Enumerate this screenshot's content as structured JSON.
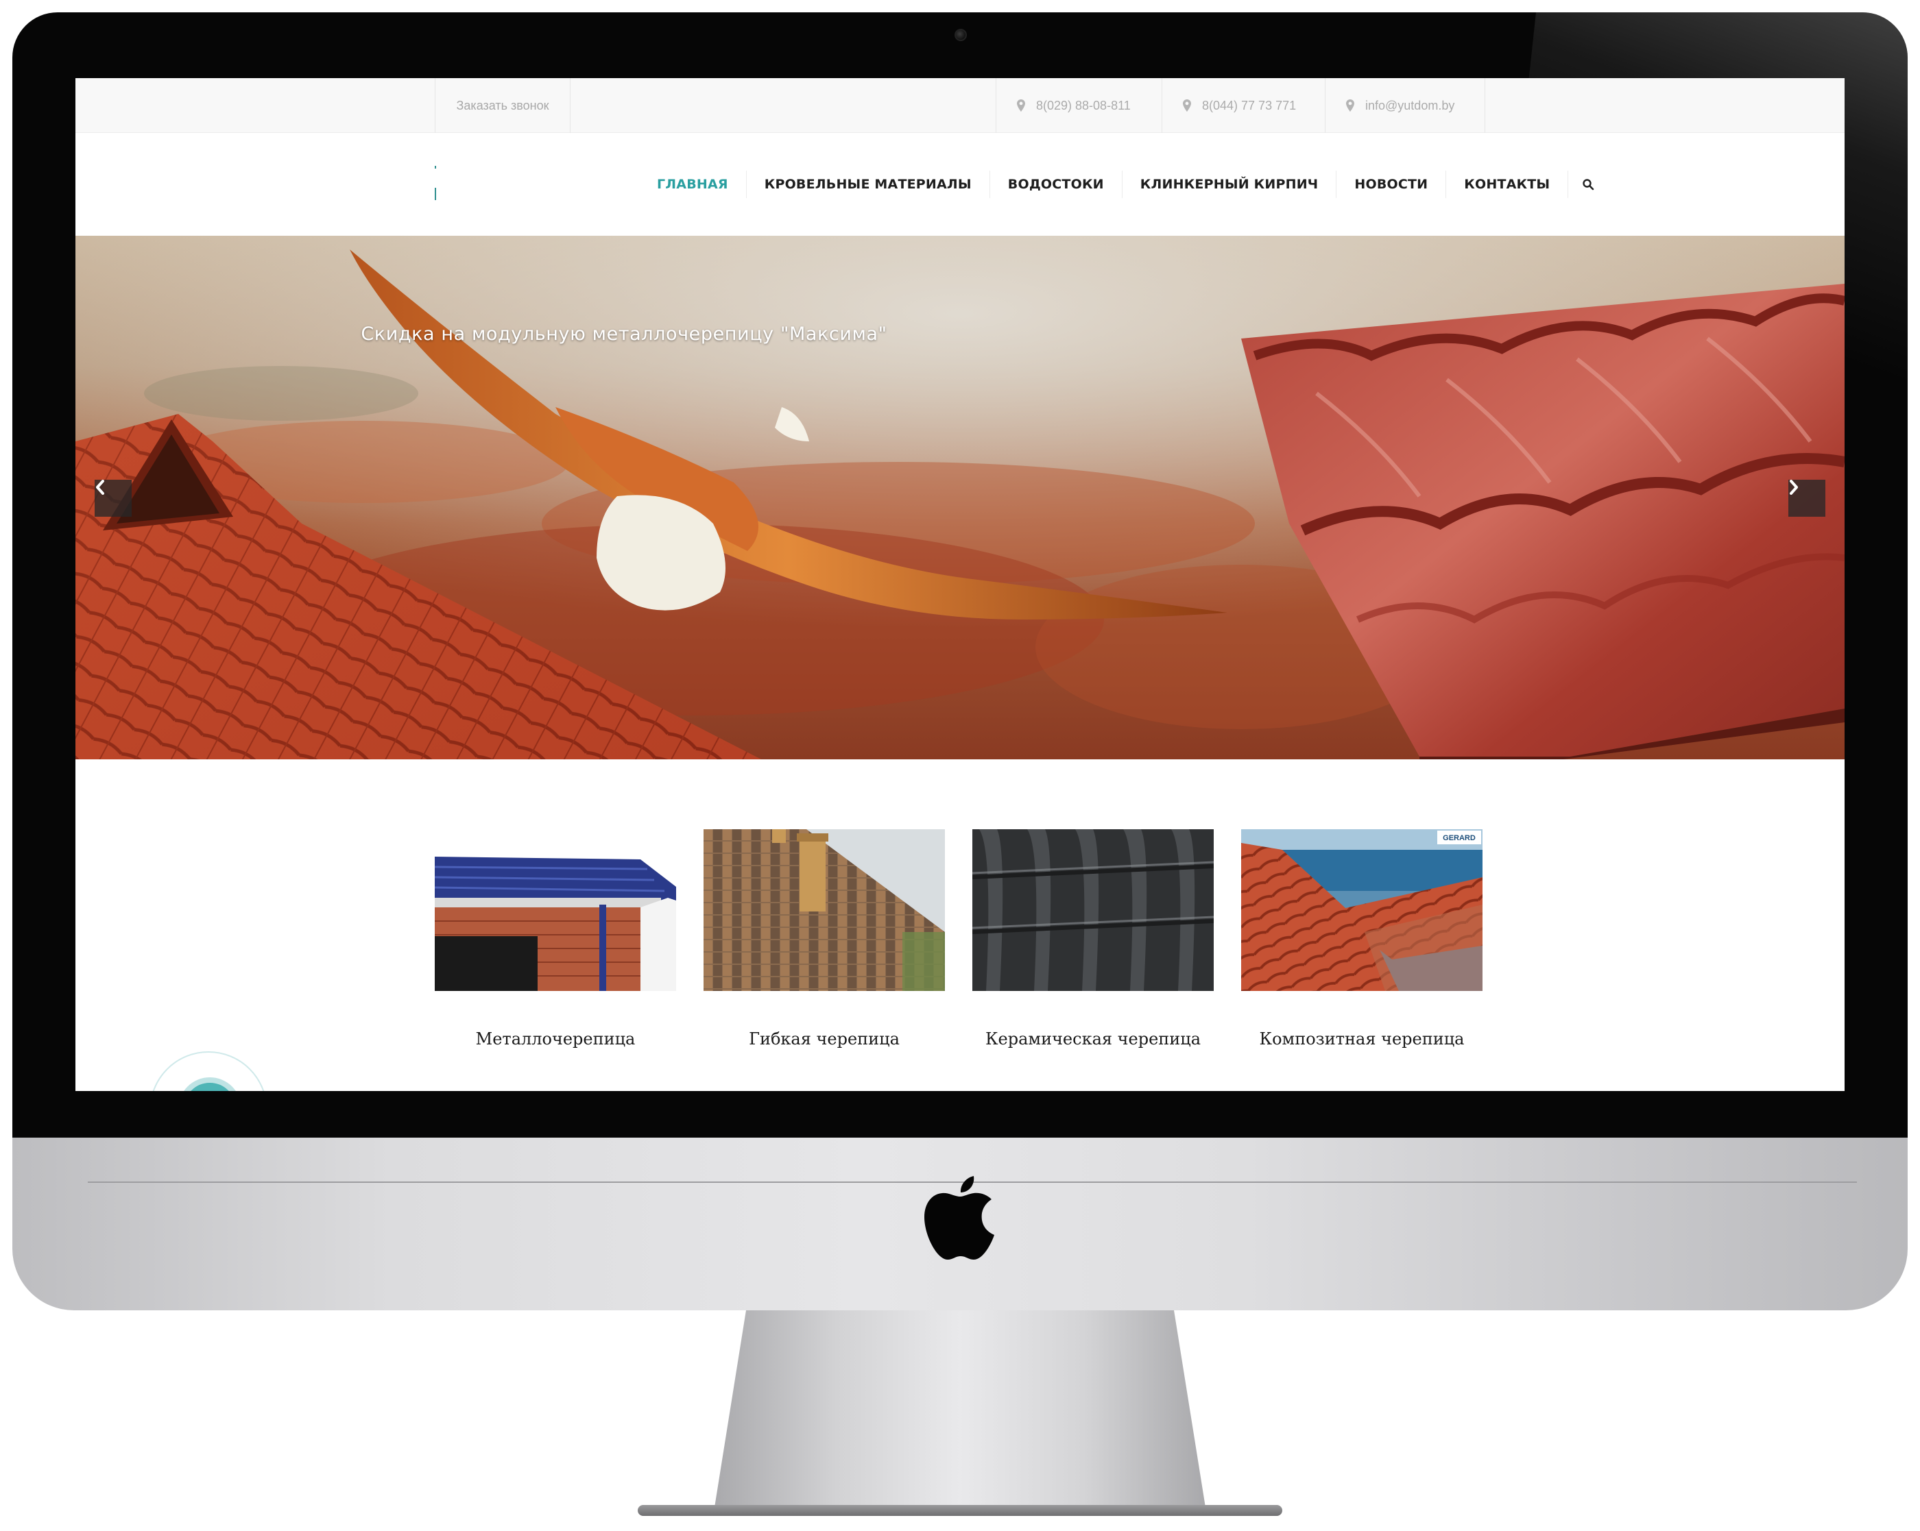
{
  "topbar": {
    "callback_label": "Заказать звонок",
    "contacts": [
      {
        "icon": "map-pin-icon",
        "text": "8(029) 88-08-811"
      },
      {
        "icon": "map-pin-icon",
        "text": "8(044) 77 73 771"
      },
      {
        "icon": "map-pin-icon",
        "text": "info@yutdom.by"
      }
    ]
  },
  "nav": {
    "items": [
      {
        "label": "ГЛАВНАЯ",
        "active": true
      },
      {
        "label": "КРОВЕЛЬНЫЕ МАТЕРИАЛЫ",
        "active": false
      },
      {
        "label": "ВОДОСТОКИ",
        "active": false
      },
      {
        "label": "КЛИНКЕРНЫЙ КИРПИЧ",
        "active": false
      },
      {
        "label": "НОВОСТИ",
        "active": false
      },
      {
        "label": "КОНТАКТЫ",
        "active": false
      }
    ],
    "search_icon": "search-icon"
  },
  "hero": {
    "caption": "Скидка на модульную металлочерепицу \"Максима\"",
    "prev_icon": "chevron-left-icon",
    "next_icon": "chevron-right-icon"
  },
  "categories": [
    {
      "label": "Металлочерепица"
    },
    {
      "label": "Гибкая черепица"
    },
    {
      "label": "Керамическая черепица"
    },
    {
      "label": "Композитная черепица",
      "brand_badge": "GERARD"
    }
  ],
  "colors": {
    "accent": "#2a9fa0",
    "nav_text": "#1e1e1e",
    "topbar_bg": "#f8f8f8",
    "bezel": "#060606",
    "chin": "#e2e2e4"
  }
}
